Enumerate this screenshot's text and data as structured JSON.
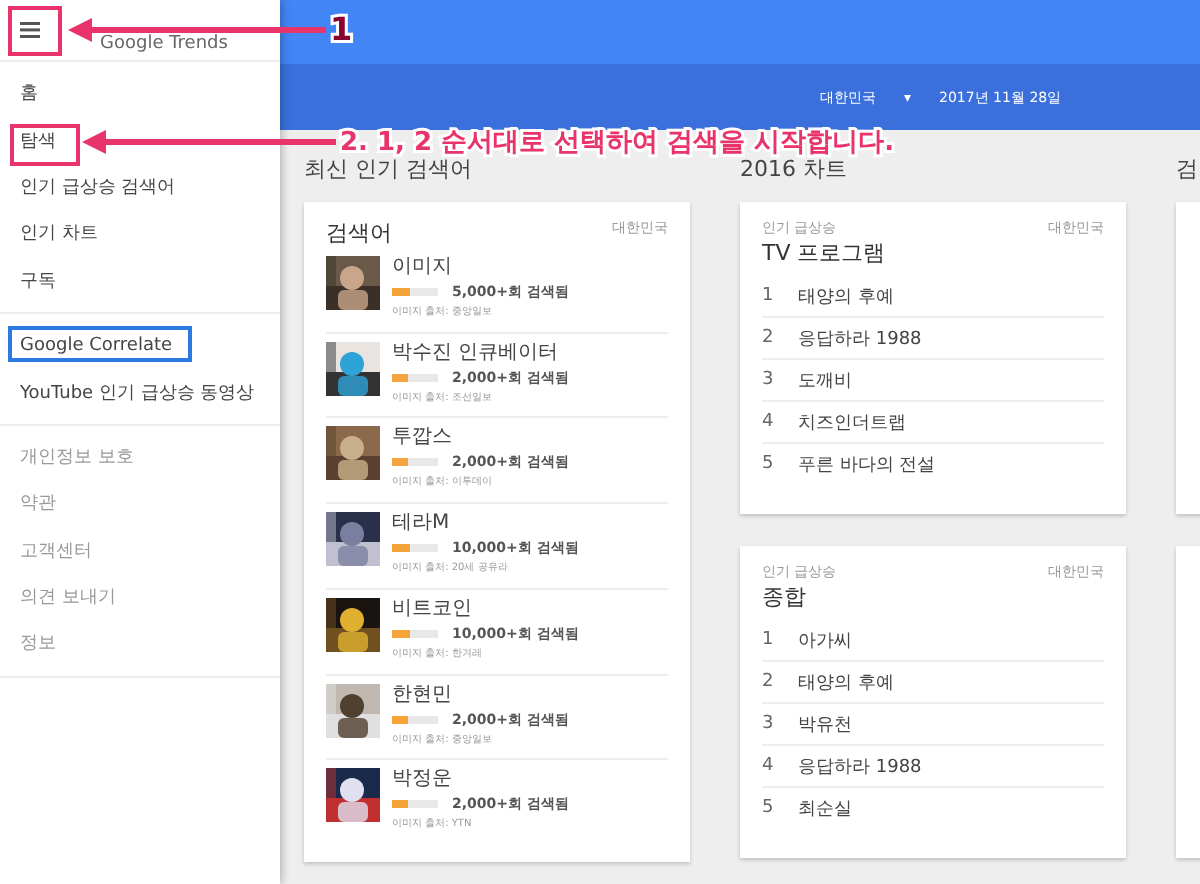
{
  "sidebar": {
    "logo": "Google Trends",
    "groups": [
      {
        "items": [
          {
            "label": "홈",
            "selected": false
          },
          {
            "label": "탐색",
            "selected": false
          },
          {
            "label": "인기 급상승 검색어",
            "selected": false
          },
          {
            "label": "인기 차트",
            "selected": false
          },
          {
            "label": "구독",
            "selected": false
          }
        ]
      },
      {
        "items": [
          {
            "label": "Google Correlate",
            "selected": false
          },
          {
            "label": "YouTube 인기 급상승 동영상",
            "selected": false
          }
        ]
      },
      {
        "items": [
          {
            "label": "개인정보 보호",
            "selected": false
          },
          {
            "label": "약관",
            "selected": false
          },
          {
            "label": "고객센터",
            "selected": false
          },
          {
            "label": "의견 보내기",
            "selected": false
          },
          {
            "label": "정보",
            "selected": false
          }
        ]
      }
    ]
  },
  "header": {
    "country": "대한민국",
    "dropdown": "▾",
    "date": "2017년 11월 28일"
  },
  "columns": [
    {
      "heading": "최신 인기 검색어",
      "cards": [
        {
          "kind": "searches",
          "title": "검색어",
          "region": "대한민국",
          "rows": [
            {
              "name": "이미지",
              "level": 0.4,
              "count": "5,000+회 검색됨",
              "source": "이미지 출처: 중앙일보"
            },
            {
              "name": "박수진 인큐베이터",
              "level": 0.35,
              "count": "2,000+회 검색됨",
              "source": "이미지 출처: 조선일보"
            },
            {
              "name": "투깝스",
              "level": 0.35,
              "count": "2,000+회 검색됨",
              "source": "이미지 출처: 이투데이"
            },
            {
              "name": "테라M",
              "level": 0.4,
              "count": "10,000+회 검색됨",
              "source": "이미지 출처: 20세 공유라"
            },
            {
              "name": "비트코인",
              "level": 0.4,
              "count": "10,000+회 검색됨",
              "source": "이미지 출처: 한겨레"
            },
            {
              "name": "한현민",
              "level": 0.35,
              "count": "2,000+회 검색됨",
              "source": "이미지 출처: 중앙일보"
            },
            {
              "name": "박정운",
              "level": 0.35,
              "count": "2,000+회 검색됨",
              "source": "이미지 출처: YTN"
            }
          ]
        }
      ]
    },
    {
      "heading": "2016 차트",
      "cards": [
        {
          "kind": "chart",
          "subtitle": "인기 급상승",
          "title": "TV 프로그램",
          "region": "대한민국",
          "items": [
            {
              "rank": "1",
              "name": "태양의 후예"
            },
            {
              "rank": "2",
              "name": "응답하라 1988"
            },
            {
              "rank": "3",
              "name": "도깨비"
            },
            {
              "rank": "4",
              "name": "치즈인더트랩"
            },
            {
              "rank": "5",
              "name": "푸른 바다의 전설"
            }
          ]
        },
        {
          "kind": "chart",
          "subtitle": "인기 급상승",
          "title": "종합",
          "region": "대한민국",
          "items": [
            {
              "rank": "1",
              "name": "아가씨"
            },
            {
              "rank": "2",
              "name": "태양의 후예"
            },
            {
              "rank": "3",
              "name": "박유천"
            },
            {
              "rank": "4",
              "name": "응답하라 1988"
            },
            {
              "rank": "5",
              "name": "최순실"
            }
          ]
        }
      ]
    },
    {
      "heading": "검",
      "cards": [
        {
          "kind": "blank"
        },
        {
          "kind": "blank"
        }
      ]
    }
  ],
  "annotations": [
    {
      "kind": "box"
    },
    {
      "kind": "arrow",
      "label": "1"
    },
    {
      "kind": "box"
    },
    {
      "kind": "arrow",
      "label": "2. 1, 2 순서대로 선택하여 검색을 시작합니다."
    },
    {
      "kind": "focus"
    }
  ]
}
